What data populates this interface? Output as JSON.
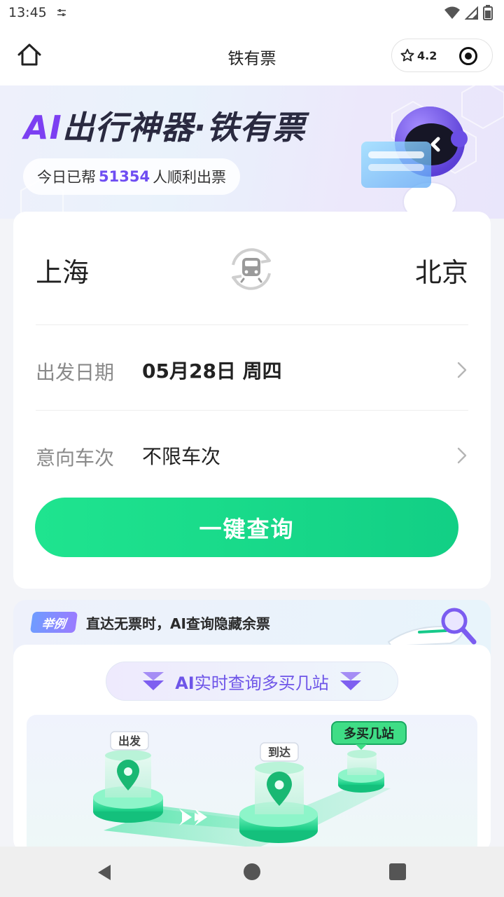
{
  "status_bar": {
    "time": "13:45"
  },
  "header": {
    "title": "铁有票",
    "rating": "4.2"
  },
  "banner": {
    "title_ai": "AI",
    "title_rest": "出行神器·铁有票",
    "helped_prefix": "今日已帮",
    "helped_count": "51354",
    "helped_suffix": "人顺利出票"
  },
  "search": {
    "from_city": "上海",
    "to_city": "北京",
    "date_label": "出发日期",
    "date_value": "05月28日 周四",
    "train_label": "意向车次",
    "train_value": "不限车次",
    "query_button": "一键查询"
  },
  "example": {
    "tag": "举例",
    "text": "直达无票时，AI查询隐藏余票",
    "pill_ai": "AI",
    "pill_rest": "实时查询多买几站",
    "illus_depart": "出发",
    "illus_arrive": "到达",
    "illus_more": "多买几站"
  },
  "colors": {
    "accent_green": "#12cf85",
    "accent_purple": "#6e55e8"
  }
}
